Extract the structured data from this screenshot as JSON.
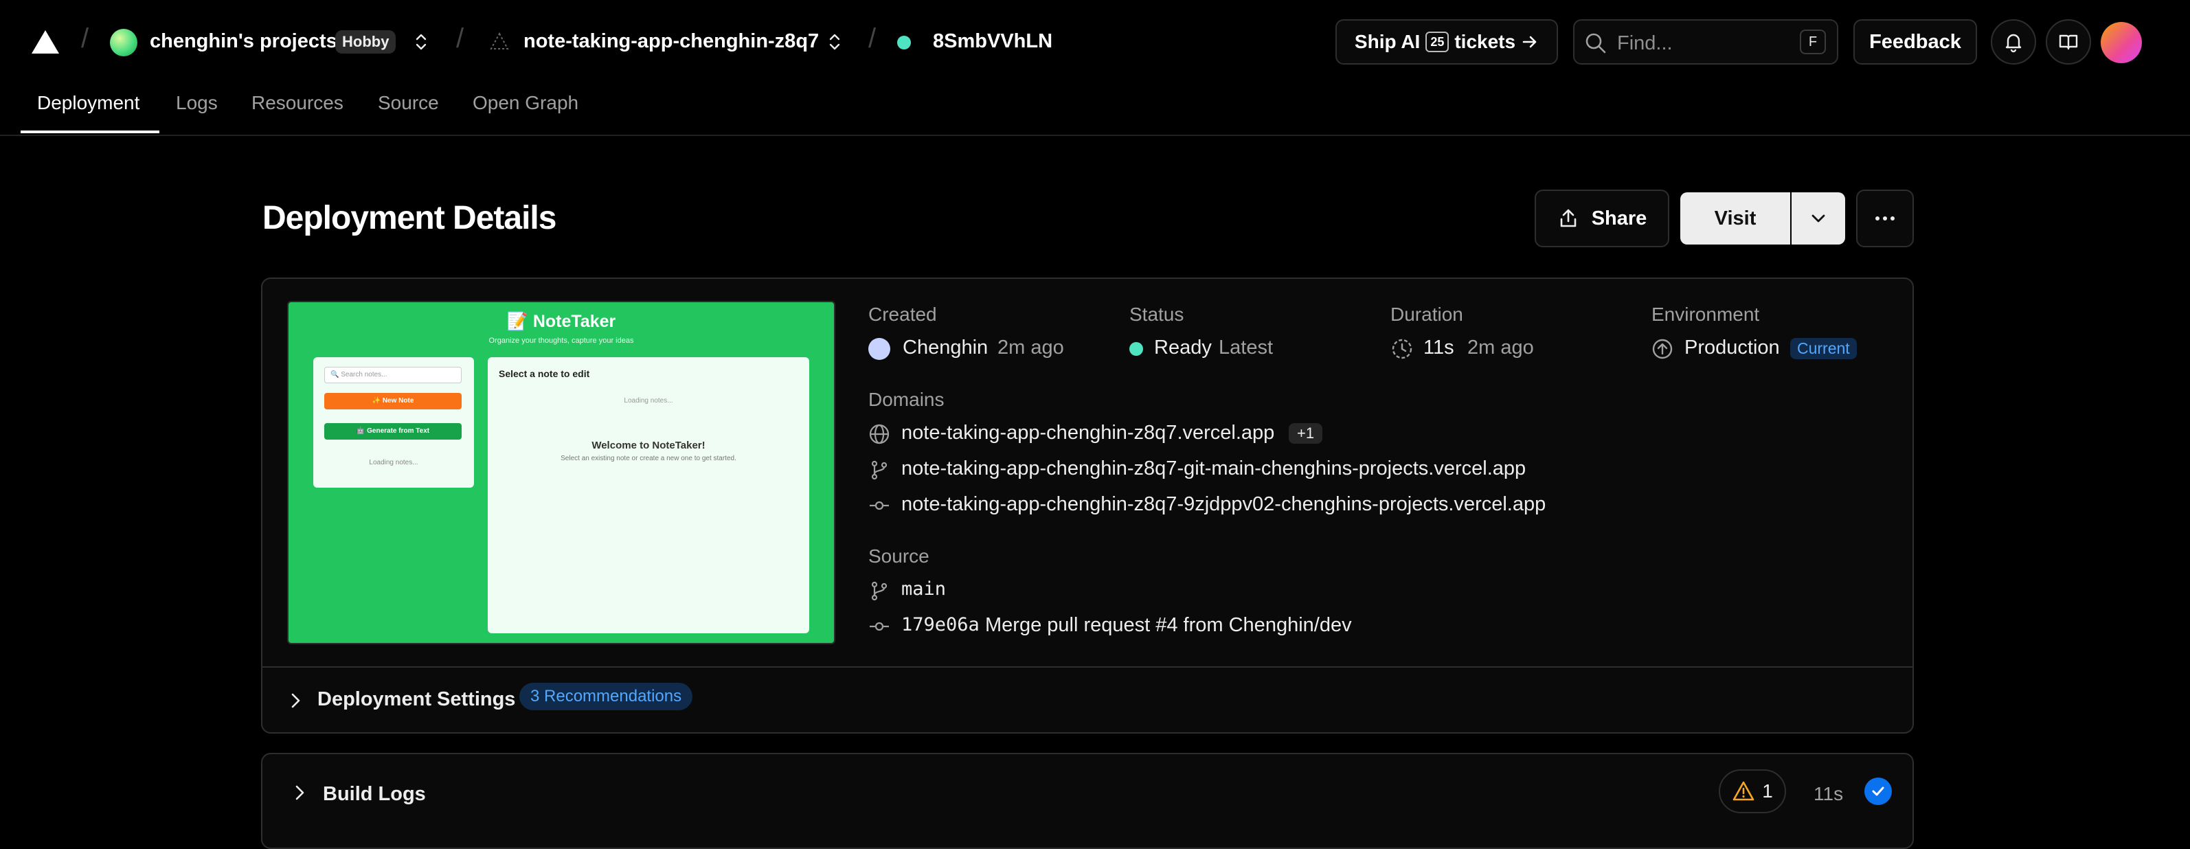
{
  "topbar": {
    "team_name": "chenghin's projects",
    "plan_badge": "Hobby",
    "project_name": "note-taking-app-chenghin-z8q7",
    "deployment_id": "8SmbVVhLN",
    "ship_ai": {
      "prefix": "Ship AI",
      "count": "25",
      "suffix": "tickets"
    },
    "find_placeholder": "Find...",
    "find_shortcut": "F",
    "feedback_label": "Feedback"
  },
  "tabs": [
    {
      "label": "Deployment",
      "active": true
    },
    {
      "label": "Logs"
    },
    {
      "label": "Resources"
    },
    {
      "label": "Source"
    },
    {
      "label": "Open Graph"
    }
  ],
  "header": {
    "title": "Deployment Details",
    "share_label": "Share",
    "visit_label": "Visit"
  },
  "preview": {
    "app_title": "📝 NoteTaker",
    "app_subtitle": "Organize your thoughts, capture your ideas",
    "search_placeholder": "🔍 Search notes...",
    "new_note": "✨ New Note",
    "generate": "🤖 Generate from Text",
    "loading_left": "Loading notes...",
    "select_prompt": "Select a note to edit",
    "loading_right": "Loading notes...",
    "welcome": "Welcome to NoteTaker!",
    "hint": "Select an existing note or create a new one to get started."
  },
  "details": {
    "created": {
      "label": "Created",
      "user": "Chenghin",
      "ago": "2m ago"
    },
    "status": {
      "label": "Status",
      "value": "Ready",
      "tag": "Latest"
    },
    "duration": {
      "label": "Duration",
      "value": "11s",
      "ago": "2m ago"
    },
    "environment": {
      "label": "Environment",
      "value": "Production",
      "badge": "Current"
    },
    "domains": {
      "label": "Domains",
      "primary": "note-taking-app-chenghin-z8q7.vercel.app",
      "extra_count": "+1",
      "branch": "note-taking-app-chenghin-z8q7-git-main-chenghins-projects.vercel.app",
      "commit": "note-taking-app-chenghin-z8q7-9zjdppv02-chenghins-projects.vercel.app"
    },
    "source": {
      "label": "Source",
      "branch": "main",
      "commit_hash": "179e06a",
      "commit_message": "Merge pull request #4 from Chenghin/dev"
    }
  },
  "settings": {
    "label": "Deployment Settings",
    "recommendations": "3 Recommendations"
  },
  "build_logs": {
    "label": "Build Logs",
    "warnings": "1",
    "duration": "11s"
  },
  "colors": {
    "accent_blue": "#0a72ef",
    "ready_green": "#50e3c2",
    "preview_green": "#22c55e",
    "warning_amber": "#f5a623"
  }
}
